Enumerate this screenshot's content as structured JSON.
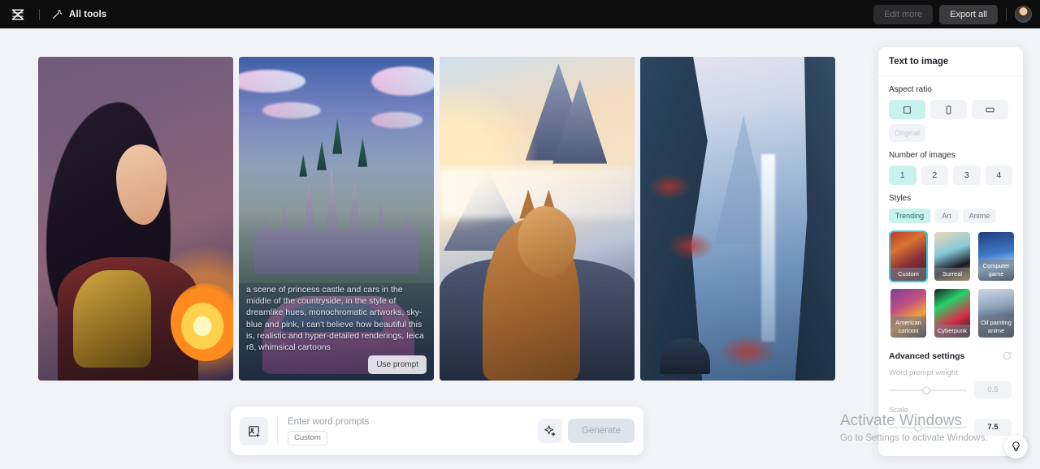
{
  "header": {
    "logo_icon": "capcut-logo-icon",
    "wand_icon": "magic-wand-icon",
    "all_tools_label": "All tools",
    "edit_more_label": "Edit more",
    "export_all_label": "Export all",
    "avatar_label": "user-avatar"
  },
  "gallery": {
    "images": [
      {
        "name": "fantasy-elf-warrior-with-fireball",
        "alt": "Dark-haired elf warrior in golden armor holding a glowing fireball"
      },
      {
        "name": "pink-car-at-princess-castle",
        "alt": "Pastel princess castle with a pink vintage car in the foreground",
        "prompt": "a scene of princess castle and cars in the middle of the countryside, in the style of dreamlike hues, monochromatic artworks, sky-blue and pink, I can't believe how beautiful this is, realistic and hyper-detailed renderings, leica r8, whimsical cartoons",
        "use_prompt_label": "Use prompt"
      },
      {
        "name": "cat-gazing-at-sunlit-mountains",
        "alt": "Tabby cat in profile looking up at glowing snowy peaks"
      },
      {
        "name": "misty-blue-valley-with-waterfall",
        "alt": "Foggy blue canyon with a waterfall, red foliage and a pagoda"
      }
    ]
  },
  "prompt_bar": {
    "add_image_icon": "add-image-icon",
    "placeholder": "Enter word prompts",
    "value": "",
    "style_chip_label": "Custom",
    "sparkle_icon": "sparkle-icon",
    "generate_label": "Generate"
  },
  "panel": {
    "title": "Text to image",
    "aspect_ratio": {
      "label": "Aspect ratio",
      "options": [
        {
          "name": "square",
          "icon": "square-ratio-icon",
          "selected": true
        },
        {
          "name": "portrait",
          "icon": "portrait-ratio-icon",
          "selected": false
        },
        {
          "name": "landscape",
          "icon": "landscape-ratio-icon",
          "selected": false
        }
      ],
      "original_label": "Original",
      "original_disabled": true
    },
    "number_of_images": {
      "label": "Number of images",
      "options": [
        "1",
        "2",
        "3",
        "4"
      ],
      "selected": "1"
    },
    "styles": {
      "label": "Styles",
      "tabs": [
        {
          "label": "Trending",
          "selected": true
        },
        {
          "label": "Art",
          "selected": false
        },
        {
          "label": "Anime",
          "selected": false
        }
      ],
      "tiles": [
        {
          "label": "Custom",
          "selected": true
        },
        {
          "label": "Surreal",
          "selected": false
        },
        {
          "label": "Computer game",
          "selected": false
        },
        {
          "label": "American cartoon",
          "selected": false
        },
        {
          "label": "Cyberpunk",
          "selected": false
        },
        {
          "label": "Oil painting anime",
          "selected": false
        }
      ]
    },
    "advanced": {
      "title": "Advanced settings",
      "reset_icon": "reset-icon",
      "word_prompt_weight": {
        "label": "Word prompt weight",
        "value": "0.5",
        "percent": 48
      },
      "scale": {
        "label": "Scale",
        "value": "7.5",
        "percent": 37
      }
    }
  },
  "watermark": {
    "line1": "Activate Windows",
    "line2": "Go to Settings to activate Windows."
  },
  "help": {
    "icon": "lightbulb-icon"
  },
  "colors": {
    "accent_mint": "#c9f2ef",
    "accent_cyan": "#2ad4e0",
    "header_bg": "#0d0d0d",
    "canvas_bg": "#f1f3f6",
    "panel_bg": "#ffffff"
  }
}
